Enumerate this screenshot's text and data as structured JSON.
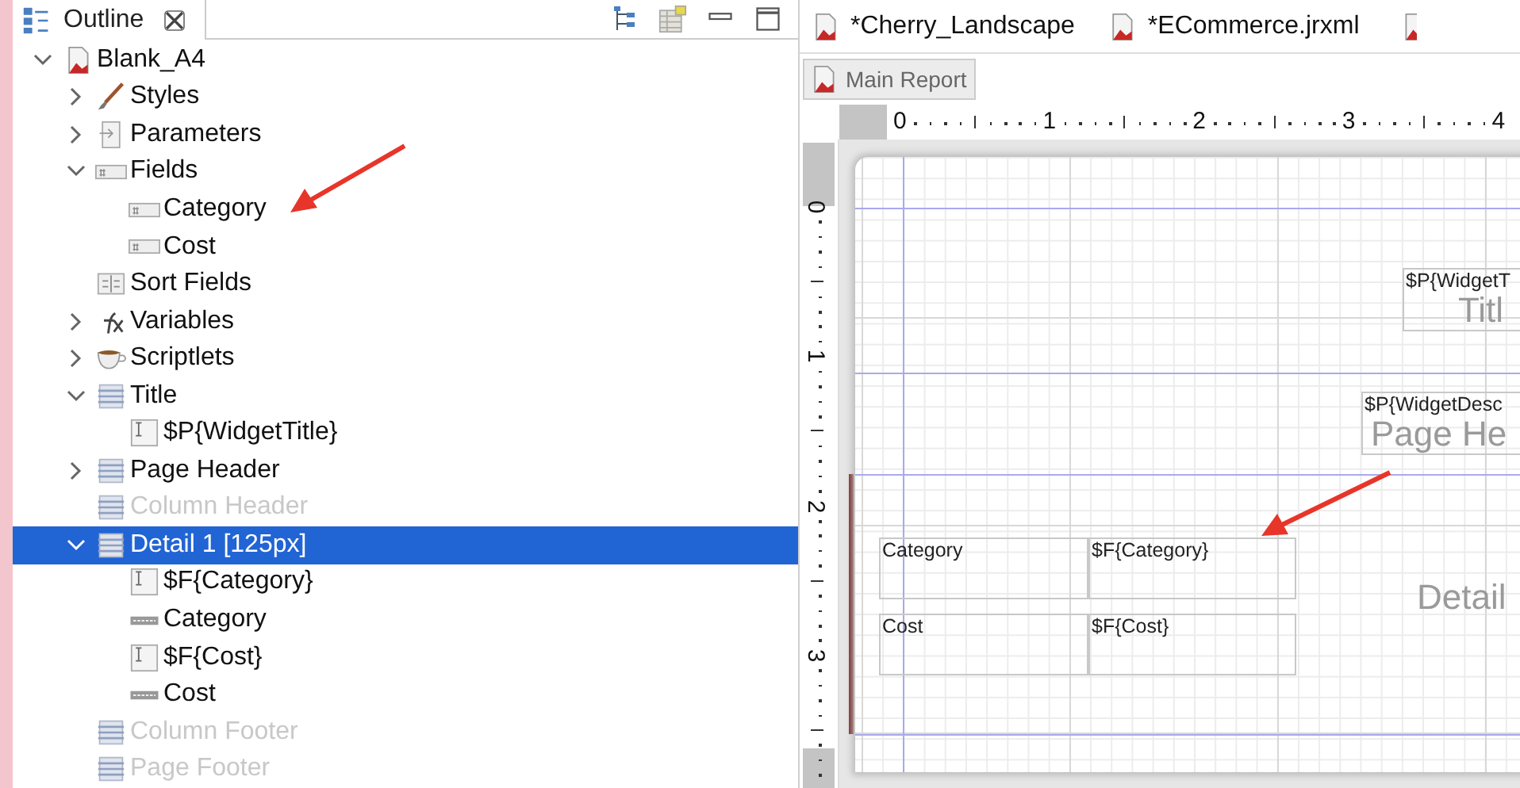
{
  "outline_view": {
    "title": "Outline"
  },
  "tree": [
    {
      "label": "Blank_A4",
      "kind": "report",
      "expanded": true,
      "selected": false,
      "disabled": false,
      "children": [
        {
          "label": "Styles",
          "kind": "styles",
          "expanded": false,
          "selected": false,
          "disabled": false
        },
        {
          "label": "Parameters",
          "kind": "parameters",
          "expanded": false,
          "selected": false,
          "disabled": false
        },
        {
          "label": "Fields",
          "kind": "field",
          "expanded": true,
          "selected": false,
          "disabled": false,
          "children": [
            {
              "label": "Category",
              "kind": "field",
              "selected": false,
              "disabled": false
            },
            {
              "label": "Cost",
              "kind": "field",
              "selected": false,
              "disabled": false
            }
          ]
        },
        {
          "label": "Sort Fields",
          "kind": "sort",
          "selected": false,
          "disabled": false
        },
        {
          "label": "Variables",
          "kind": "variables",
          "expanded": false,
          "selected": false,
          "disabled": false
        },
        {
          "label": "Scriptlets",
          "kind": "scriptlets",
          "expanded": false,
          "selected": false,
          "disabled": false
        },
        {
          "label": "Title",
          "kind": "band",
          "expanded": true,
          "selected": false,
          "disabled": false,
          "children": [
            {
              "label": "$P{WidgetTitle}",
              "kind": "textfield",
              "selected": false,
              "disabled": false
            }
          ]
        },
        {
          "label": "Page Header",
          "kind": "band",
          "expanded": false,
          "selected": false,
          "disabled": false
        },
        {
          "label": "Column Header",
          "kind": "band",
          "selected": false,
          "disabled": true
        },
        {
          "label": "Detail 1 [125px]",
          "kind": "band",
          "expanded": true,
          "selected": true,
          "disabled": false,
          "children": [
            {
              "label": "$F{Category}",
              "kind": "textfield",
              "selected": false,
              "disabled": false
            },
            {
              "label": "Category",
              "kind": "label",
              "selected": false,
              "disabled": false
            },
            {
              "label": "$F{Cost}",
              "kind": "textfield",
              "selected": false,
              "disabled": false
            },
            {
              "label": "Cost",
              "kind": "label",
              "selected": false,
              "disabled": false
            }
          ]
        },
        {
          "label": "Column Footer",
          "kind": "band",
          "selected": false,
          "disabled": true
        },
        {
          "label": "Page Footer",
          "kind": "band",
          "selected": false,
          "disabled": true
        }
      ]
    }
  ],
  "editor": {
    "tabs": [
      {
        "label": "*Cherry_Landscape"
      },
      {
        "label": "*ECommerce.jrxml"
      }
    ],
    "breadcrumb": "Main Report",
    "rulers": {
      "horizontal": [
        "0",
        "1",
        "2",
        "3",
        "4"
      ],
      "vertical": [
        "0",
        "1",
        "2",
        "3"
      ]
    },
    "canvas": {
      "band_labels": [
        "Titl",
        "Page He",
        "Detail"
      ],
      "elements": [
        {
          "text": "$P{WidgetT"
        },
        {
          "text": "$P{WidgetDesc"
        },
        {
          "text": "Category"
        },
        {
          "text": "$F{Category}"
        },
        {
          "text": "Cost"
        },
        {
          "text": "$F{Cost}"
        }
      ]
    }
  }
}
